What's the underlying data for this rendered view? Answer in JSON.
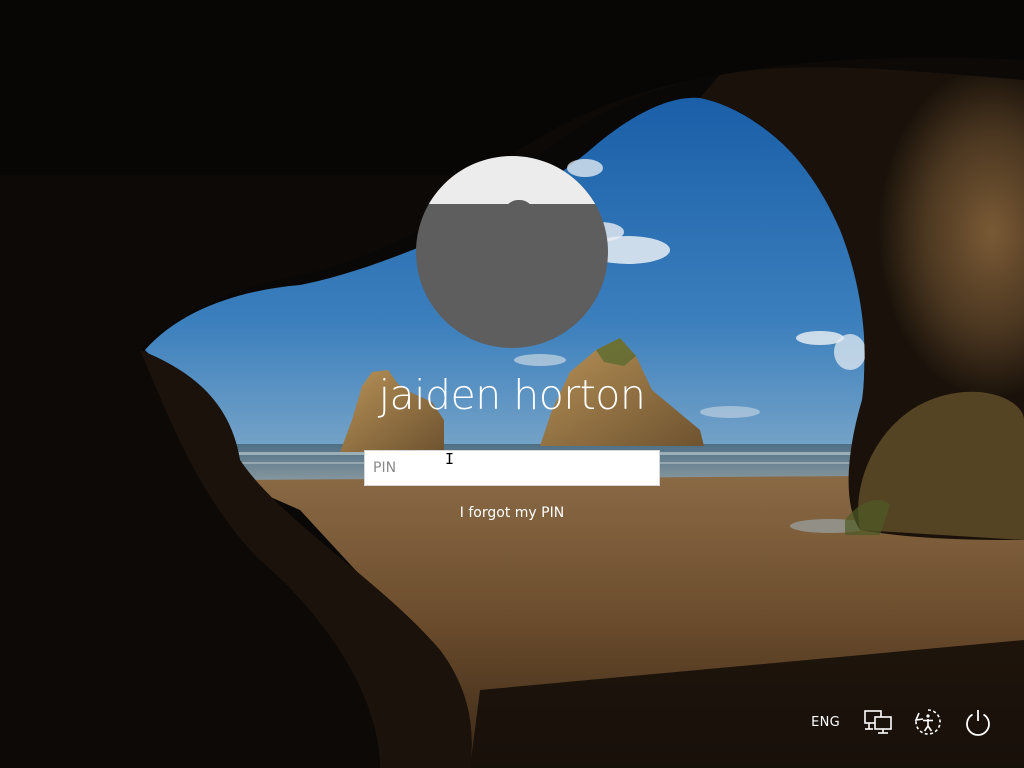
{
  "user": {
    "name": "jaiden horton"
  },
  "pin": {
    "placeholder": "PIN",
    "value": ""
  },
  "links": {
    "forgot_pin": "I forgot my PIN"
  },
  "tray": {
    "language": "ENG",
    "icons": [
      "network-icon",
      "ease-of-access-icon",
      "power-icon"
    ]
  },
  "colors": {
    "avatar_bg": "#5e5e5e",
    "avatar_top": "#ececec",
    "text": "#ffffff",
    "sky": "#2f6ea6",
    "sand": "#6b4c2c"
  }
}
